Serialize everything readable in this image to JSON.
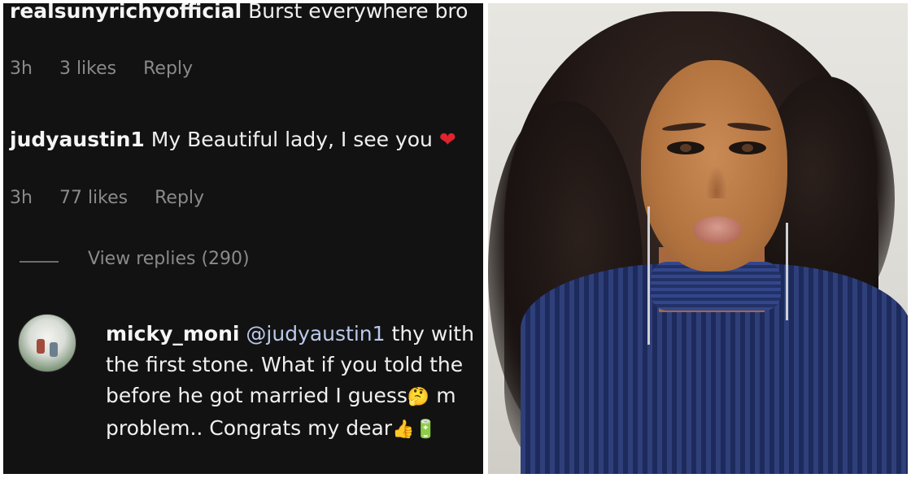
{
  "comments": [
    {
      "username": "realsunyrichyofficial",
      "text": "Burst everywhere bro",
      "time": "3h",
      "likes": "3 likes",
      "reply_label": "Reply"
    },
    {
      "username": "judyaustin1",
      "text": "My Beautiful lady, I see you",
      "emoji": "❤",
      "time": "3h",
      "likes": "77 likes",
      "reply_label": "Reply"
    }
  ],
  "view_replies": "View replies (290)",
  "reply": {
    "username": "micky_moni",
    "mention": "@judyaustin1",
    "line1": "thy with",
    "line2": "the first stone. What if you told the",
    "line3": "before he got married I guess",
    "line3_emoji": "🤔",
    "line3_tail": "m",
    "line4": "problem.. Congrats my dear",
    "line4_emoji1": "👍",
    "line4_emoji2": "🔋"
  },
  "icons": {
    "heart": "heart-icon",
    "avatar": "avatar"
  },
  "colors": {
    "panel_bg": "#121212",
    "meta_text": "#8a8a8a",
    "mention": "#b9c9ea",
    "heart": "#e0232e"
  }
}
